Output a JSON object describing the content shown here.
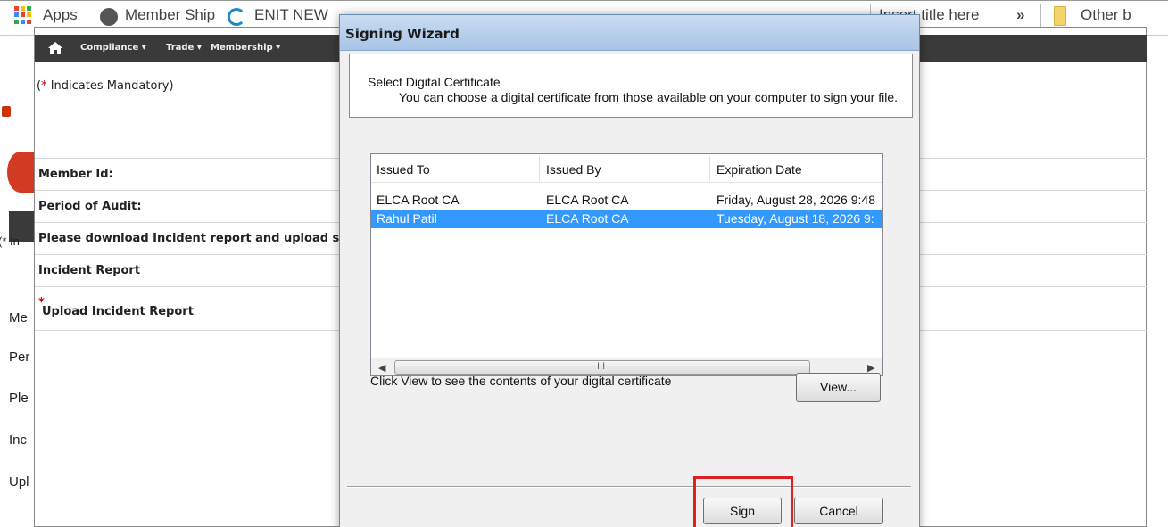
{
  "bookmarks": {
    "apps": "Apps",
    "membership": "Member Ship",
    "enit": "ENIT NEW",
    "insert_title": "Insert title here",
    "more": "»",
    "other": "Other b"
  },
  "left_strip": {
    "rows": [
      "Me",
      "Per",
      "Ple",
      "Inc",
      "Upl"
    ],
    "note_fragment": "(* In"
  },
  "app": {
    "nav": {
      "compliance": "Compliance ▾",
      "trade": "Trade ▾",
      "membership": "Membership ▾"
    },
    "mandatory_star": "*",
    "mandatory_text": " Indicates Mandatory)",
    "mandatory_open": "(",
    "form": {
      "member_id": "Member Id:",
      "period": "Period of Audit:",
      "download_note": "Please download Incident report and upload same f",
      "incident_report": "Incident Report",
      "upload_label": "Upload Incident Report",
      "upload_req": "*"
    }
  },
  "dialog": {
    "title": "Signing Wizard",
    "header_title": "Select Digital Certificate",
    "header_sub": "You can choose a digital certificate from those available on your computer to sign your file.",
    "columns": [
      "Issued To",
      "Issued By",
      "Expiration Date"
    ],
    "certificates": [
      {
        "issued_to": "ELCA Root CA",
        "issued_by": "ELCA Root CA",
        "expiration": "Friday, August 28, 2026 9:48",
        "selected": false
      },
      {
        "issued_to": "Rahul Patil",
        "issued_by": "ELCA Root CA",
        "expiration": "Tuesday, August 18, 2026 9:",
        "selected": true
      }
    ],
    "scroll_grip": "III",
    "view_hint": "Click View to see the contents of your digital certificate",
    "view_button": "View...",
    "sign_button": "Sign",
    "cancel_button": "Cancel"
  },
  "colors": {
    "nav_bg": "#3a3a3a",
    "selection": "#3399ff",
    "highlight": "#e02020",
    "required": "#cc0000"
  }
}
